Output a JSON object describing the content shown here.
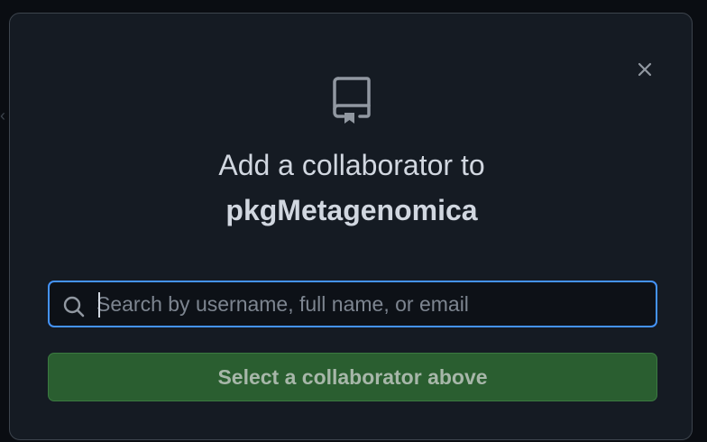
{
  "dialog": {
    "title": "Add a collaborator to",
    "repo_name": "pkgMetagenomica",
    "close_label": "×"
  },
  "search": {
    "placeholder": "Search by username, full name, or email",
    "value": ""
  },
  "submit": {
    "label": "Select a collaborator above",
    "disabled": true
  },
  "icons": {
    "repo": "repo-icon",
    "close": "close-icon",
    "search": "search-icon"
  },
  "colors": {
    "dialog_bg": "#151b23",
    "focus_border": "#4493f8",
    "button_green": "#2a5e30",
    "text": "#d1d7e0",
    "muted": "#7d8590"
  }
}
